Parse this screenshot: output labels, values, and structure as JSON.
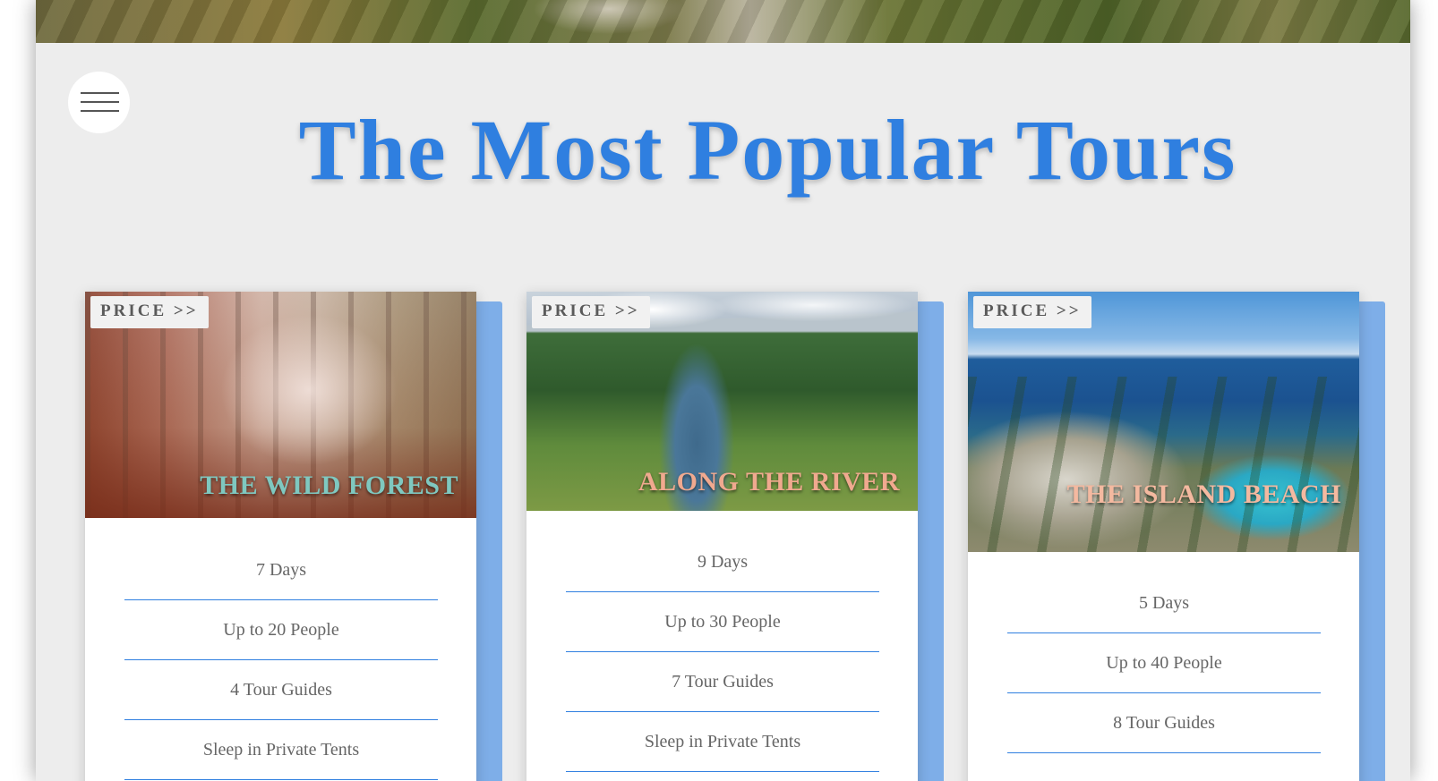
{
  "page": {
    "title": "The Most Popular Tours"
  },
  "menu": {
    "icon": "hamburger-menu-icon"
  },
  "tours": [
    {
      "name": "The Wild Forest",
      "price_label": "PRICE >>",
      "name_color": "#7fc8c0",
      "details": [
        "7 Days",
        "Up to 20 People",
        "4 Tour Guides",
        "Sleep in Private Tents"
      ]
    },
    {
      "name": "Along the River",
      "price_label": "PRICE >>",
      "name_color": "#f0a98f",
      "details": [
        "9 Days",
        "Up to 30 People",
        "7 Tour Guides",
        "Sleep in Private Tents"
      ]
    },
    {
      "name": "The Island Beach",
      "price_label": "PRICE >>",
      "name_color": "#f4b9a0",
      "details": [
        "5 Days",
        "Up to 40 People",
        "8 Tour Guides"
      ]
    }
  ],
  "colors": {
    "accent": "#2f7fe0",
    "card_back": "#7eaee8",
    "page_bg": "#ededed"
  }
}
